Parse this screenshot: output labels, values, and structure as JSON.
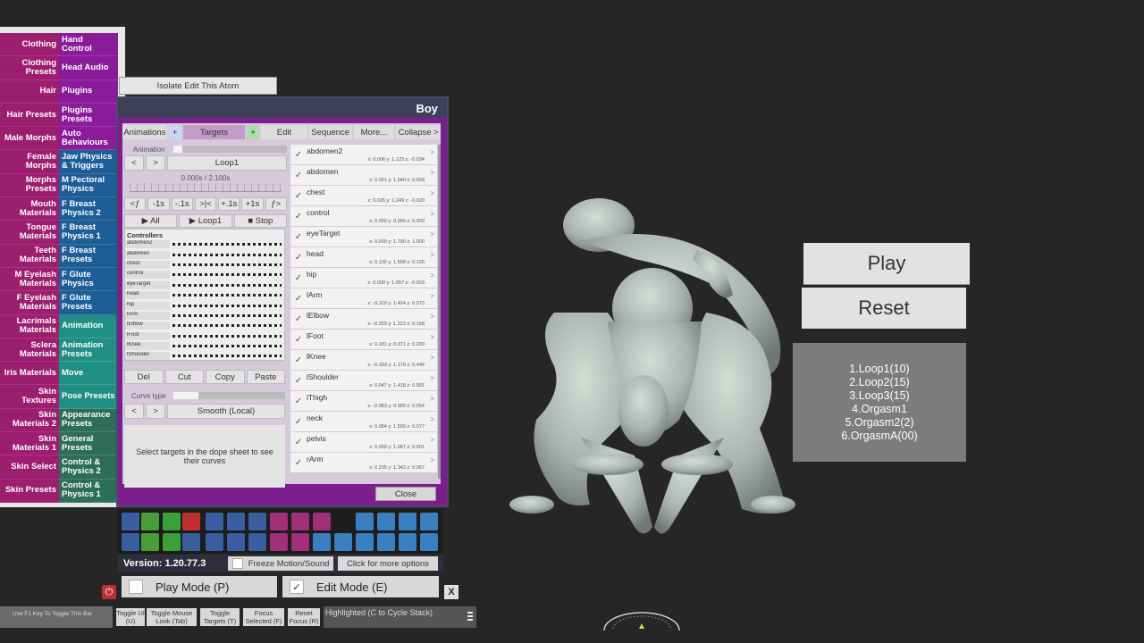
{
  "left_menu": [
    {
      "left": "Clothing",
      "right": "Hand Control",
      "color": "purple"
    },
    {
      "left": "Clothing Presets",
      "right": "Head Audio",
      "color": "purple"
    },
    {
      "left": "Hair",
      "right": "Plugins",
      "color": "purple"
    },
    {
      "left": "Hair Presets",
      "right": "Plugins Presets",
      "color": "purple"
    },
    {
      "left": "Male Morphs",
      "right": "Auto Behaviours",
      "color": "purple"
    },
    {
      "left": "Female Morphs",
      "right": "Jaw Physics & Triggers",
      "color": "blue"
    },
    {
      "left": "Morphs Presets",
      "right": "M Pectoral Physics",
      "color": "blue"
    },
    {
      "left": "Mouth Materials",
      "right": "F Breast Physics 2",
      "color": "blue"
    },
    {
      "left": "Tongue Materials",
      "right": "F Breast Physics 1",
      "color": "blue"
    },
    {
      "left": "Teeth Materials",
      "right": "F Breast Presets",
      "color": "blue"
    },
    {
      "left": "M Eyelash Materials",
      "right": "F Glute Physics",
      "color": "blue"
    },
    {
      "left": "F Eyelash Materials",
      "right": "F Glute Presets",
      "color": "blue"
    },
    {
      "left": "Lacrimals Materials",
      "right": "Animation",
      "color": "teal"
    },
    {
      "left": "Sclera Materials",
      "right": "Animation Presets",
      "color": "teal"
    },
    {
      "left": "Iris Materials",
      "right": "Move",
      "color": "teal"
    },
    {
      "left": "Skin Textures",
      "right": "Pose Presets",
      "color": "teal"
    },
    {
      "left": "Skin Materials 2",
      "right": "Appearance Presets",
      "color": "green"
    },
    {
      "left": "Skin Materials 1",
      "right": "General Presets",
      "color": "green"
    },
    {
      "left": "Skin Select",
      "right": "Control & Physics 2",
      "color": "green"
    },
    {
      "left": "Skin Presets",
      "right": "Control & Physics 1",
      "color": "green"
    }
  ],
  "isolate_label": "Isolate Edit This Atom",
  "panel": {
    "title": "Boy",
    "tabs": [
      "Animations",
      "+",
      "Targets",
      "+",
      "Edit",
      "Sequence",
      "More...",
      "Collapse >"
    ],
    "animation_label": "Animation",
    "loop_name": "Loop1",
    "time": "0.000s / 2.100s",
    "step_buttons": [
      "<ƒ",
      "-1s",
      "-.1s",
      ">|<",
      "+.1s",
      "+1s",
      "ƒ>"
    ],
    "play_all": "▶ All",
    "play_loop": "▶ Loop1",
    "stop": "■ Stop",
    "controllers_label": "Controllers",
    "controllers": [
      "abdomen2",
      "abdomen",
      "chest",
      "control",
      "eyeTarget",
      "head",
      "hip",
      "lArm",
      "lElbow",
      "lFoot",
      "lKnee",
      "lShoulder"
    ],
    "edit_buttons": [
      "Del",
      "Cut",
      "Copy",
      "Paste"
    ],
    "curve_type_label": "Curve type",
    "curve_type_value": "Smooth (Local)",
    "hint": "Select targets in the dope sheet to see their curves",
    "close": "Close",
    "targets": [
      {
        "name": "abdomen2",
        "vals": "x: 0.006 y: 1.123 z: -0.034"
      },
      {
        "name": "abdomen",
        "vals": "x: 0.001 y: 1.040 z: 0.008"
      },
      {
        "name": "chest",
        "vals": "x: 0.026 y: 1.249 z: -0.020"
      },
      {
        "name": "control",
        "vals": "x: 0.000 y: 0.000 z: 0.000"
      },
      {
        "name": "eyeTarget",
        "vals": "x: 0.000 y: 1.700 z: 1.000"
      },
      {
        "name": "head",
        "vals": "x: 0.130 y: 1.558 z: 0.126"
      },
      {
        "name": "hip",
        "vals": "x: 0.000 y: 1.057 z: -0.003"
      },
      {
        "name": "lArm",
        "vals": "x: -0.120 y: 1.424 z: 0.073"
      },
      {
        "name": "lElbow",
        "vals": "x: -0.293 y: 1.223 z: 0.168"
      },
      {
        "name": "lFoot",
        "vals": "x: 0.181 y: 0.971 z: 0.230"
      },
      {
        "name": "lKnee",
        "vals": "x: -0.183 y: 1.179 z: 0.446"
      },
      {
        "name": "lShoulder",
        "vals": "x: 0.047 y: 1.418 z: 0.091"
      },
      {
        "name": "lThigh",
        "vals": "x: -0.083 y: 0.999 z: 0.054"
      },
      {
        "name": "neck",
        "vals": "x: 0.084 y: 1.500 z: 0.077"
      },
      {
        "name": "pelvis",
        "vals": "x: 0.000 y: 1.087 z: 0.001"
      },
      {
        "name": "rArm",
        "vals": "x: 0.235 y: 1.343 z: 0.067"
      }
    ]
  },
  "version": "Version: 1.20.77.3",
  "freeze_label": "Freeze Motion/Sound",
  "more_options_label": "Click for more options",
  "play_mode": "Play Mode (P)",
  "edit_mode": "Edit Mode (E)",
  "x_label": "X",
  "f1_hint": "Use F1 Key To Toggle This Bar",
  "bottom_buttons": [
    "Toggle UI (U)",
    "Toggle Mouse Look (Tab)",
    "Toggle Targets (T)",
    "Focus Selected (F)",
    "Reset Focus (R)"
  ],
  "highlighted": "Highlighted (C to Cycle Stack)",
  "scene": {
    "play": "Play",
    "reset": "Reset",
    "loops": [
      "1.Loop1(10)",
      "2.Loop2(15)",
      "3.Loop3(15)",
      "4.Orgasm1",
      "5.Orgasm2(2)",
      "6.OrgasmA(00)"
    ]
  },
  "toolbar_icons": [
    "menu-icon",
    "open-scene-icon",
    "folder-icon",
    "save-icon",
    "cloud-icon",
    "package-icon",
    "info-icon",
    "add-person-icon",
    "hand-icon",
    "pointer-hand-icon",
    "person-icon",
    "share-icon",
    "flag-icon",
    "plus-icon",
    "star-icon",
    "open-icon",
    "screenshot-icon",
    "camera-icon",
    "nodes-icon",
    "box-icon",
    "document-icon",
    "person-lock-icon",
    "grab-icon",
    "rewind-icon",
    "play-icon",
    "target-icon",
    "cursor-icon",
    "people-icon",
    "tools-icon"
  ]
}
